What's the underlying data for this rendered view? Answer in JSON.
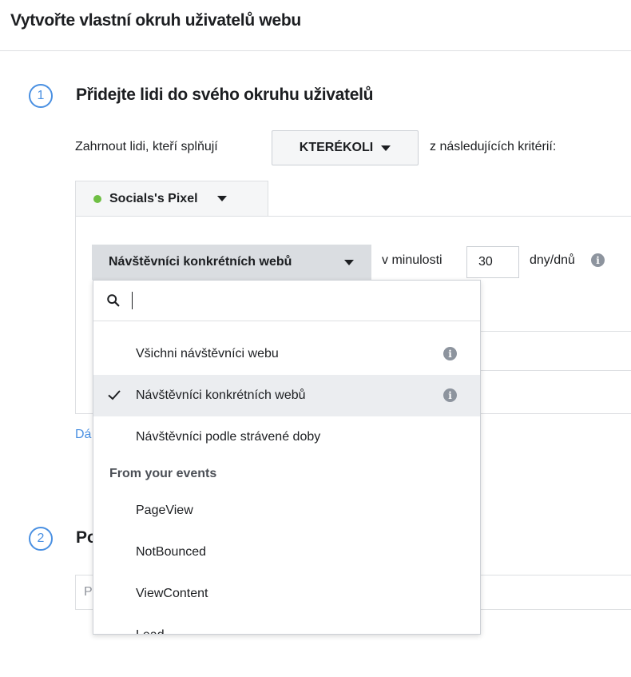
{
  "page": {
    "title": "Vytvořte vlastní okruh uživatelů webu"
  },
  "step1": {
    "number": "1",
    "title": "Přidejte lidi do svého okruhu uživatelů",
    "include_prefix": "Zahrnout lidi, kteří splňují",
    "any_label": "KTERÉKOLI",
    "include_suffix": "z následujících kritérií:",
    "pixel_tab": {
      "label": "Socials's Pixel",
      "status_color": "#6fbf44"
    },
    "rule": {
      "visitors_select": "Návštěvníci konkrétních webů",
      "in_last_label": "v minulosti",
      "days_value": "30",
      "days_unit": "dny/dnů"
    },
    "add_link_fragment": "Dá"
  },
  "dropdown": {
    "search_placeholder": "",
    "options": [
      {
        "label": "Všichni návštěvníci webu",
        "selected": false,
        "info": true
      },
      {
        "label": "Návštěvníci konkrétních webů",
        "selected": true,
        "info": true
      },
      {
        "label": "Návštěvníci podle strávené doby",
        "selected": false,
        "info": false
      }
    ],
    "events_header": "From your events",
    "events": [
      "PageView",
      "NotBounced",
      "ViewContent",
      "Lead"
    ]
  },
  "step2": {
    "number": "2",
    "title_fragment": "Po",
    "input_fragment": "P"
  },
  "colors": {
    "accent": "#4a90e2",
    "selected_bg": "#ebedf0",
    "select_bg": "#dadde1"
  }
}
